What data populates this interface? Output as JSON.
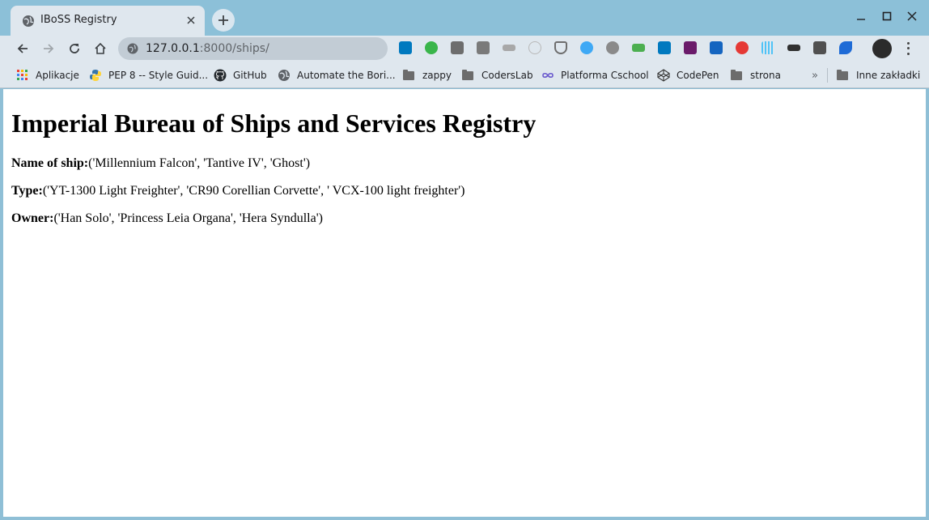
{
  "tab": {
    "title": "IBoSS Registry"
  },
  "omnibox": {
    "host": "127.0.0.1",
    "path": ":8000/ships/"
  },
  "bookmarks": [
    {
      "label": "Aplikacje",
      "icon": "apps-grid-icon"
    },
    {
      "label": "PEP 8 -- Style Guid...",
      "icon": "python-icon"
    },
    {
      "label": "GitHub",
      "icon": "github-icon"
    },
    {
      "label": "Automate the Bori...",
      "icon": "globe-icon"
    },
    {
      "label": "zappy",
      "icon": "folder-icon"
    },
    {
      "label": "CodersLab",
      "icon": "folder-icon"
    },
    {
      "label": "Platforma Cschool",
      "icon": "infinity-icon"
    },
    {
      "label": "CodePen",
      "icon": "codepen-icon"
    },
    {
      "label": "strona",
      "icon": "folder-icon"
    },
    {
      "label": "Inne zakładki",
      "icon": "folder-icon"
    }
  ],
  "bookmarks_overflow": "»",
  "page": {
    "heading": "Imperial Bureau of Ships and Services Registry",
    "fields": [
      {
        "label": "Name of ship:",
        "value": "('Millennium Falcon', 'Tantive IV', 'Ghost')"
      },
      {
        "label": "Type:",
        "value": "('YT-1300 Light Freighter', 'CR90 Corellian Corvette', ' VCX-100 light freighter')"
      },
      {
        "label": "Owner:",
        "value": "('Han Solo', 'Princess Leia Organa', 'Hera Syndulla')"
      }
    ]
  },
  "colors": {
    "titlebar": "#8cc0d8",
    "toolbar": "#dfe7ee",
    "omnibox": "#c2ccd5",
    "page_bg": "#ffffff"
  }
}
